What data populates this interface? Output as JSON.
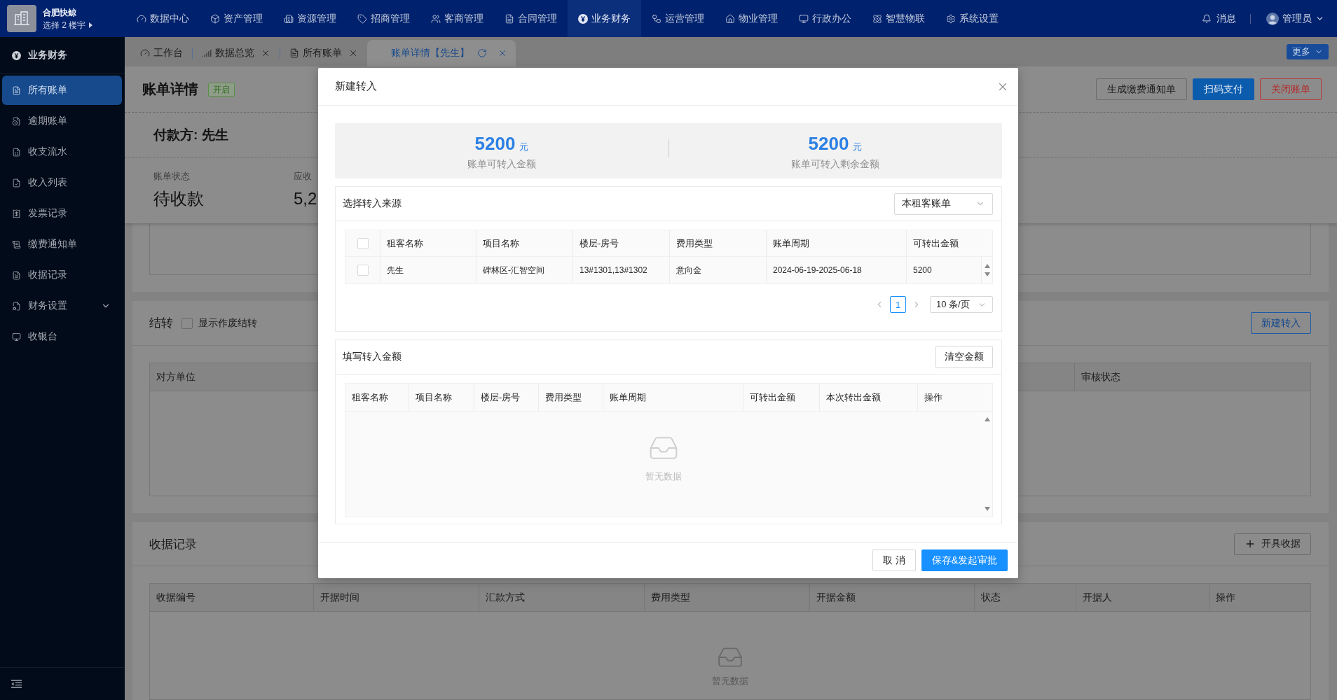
{
  "top_bar": {
    "brand_name": "合肥快鲸",
    "building_select": "选择 2 楼宇",
    "nav": [
      {
        "label": "数据中心",
        "selected": false
      },
      {
        "label": "资产管理",
        "selected": false
      },
      {
        "label": "资源管理",
        "selected": false
      },
      {
        "label": "招商管理",
        "selected": false
      },
      {
        "label": "客商管理",
        "selected": false
      },
      {
        "label": "合同管理",
        "selected": false
      },
      {
        "label": "业务财务",
        "selected": true
      },
      {
        "label": "运营管理",
        "selected": false
      },
      {
        "label": "物业管理",
        "selected": false
      },
      {
        "label": "行政办公",
        "selected": false
      },
      {
        "label": "智慧物联",
        "selected": false
      },
      {
        "label": "系统设置",
        "selected": false
      }
    ],
    "messages": "消息",
    "user": "管理员"
  },
  "sidebar": {
    "title": "业务财务",
    "items": [
      {
        "label": "所有账单",
        "selected": true,
        "kind": "link"
      },
      {
        "label": "逾期账单",
        "selected": false,
        "kind": "link"
      },
      {
        "label": "收支流水",
        "selected": false,
        "kind": "link"
      },
      {
        "label": "收入列表",
        "selected": false,
        "kind": "link"
      },
      {
        "label": "发票记录",
        "selected": false,
        "kind": "link"
      },
      {
        "label": "缴费通知单",
        "selected": false,
        "kind": "link"
      },
      {
        "label": "收据记录",
        "selected": false,
        "kind": "link"
      },
      {
        "label": "财务设置",
        "selected": false,
        "kind": "submenu"
      },
      {
        "label": "收银台",
        "selected": false,
        "kind": "link"
      }
    ]
  },
  "tabs": [
    {
      "label": "工作台",
      "selected": false,
      "closable": false
    },
    {
      "label": "数据总览",
      "selected": false,
      "closable": true
    },
    {
      "label": "所有账单",
      "selected": false,
      "closable": true
    },
    {
      "label": "账单详情【先生】",
      "selected": true,
      "closable": true
    }
  ],
  "more_button": "更多",
  "bill": {
    "title": "账单详情",
    "status_tag": "开启",
    "actions": [
      {
        "label": "生成缴费通知单",
        "kind": "default"
      },
      {
        "label": "扫码支付",
        "kind": "primary"
      },
      {
        "label": "关闭账单",
        "kind": "danger"
      }
    ],
    "payer": "付款方: 先生",
    "fields": [
      {
        "label": "账单状态",
        "value": "待收款"
      },
      {
        "label": "应收",
        "value": "5,2"
      }
    ]
  },
  "carryover": {
    "title": "结转",
    "show_void": {
      "label": "显示作废结转",
      "checked": false
    },
    "action": "新建转入",
    "columns": [
      "对方单位",
      "审核状态"
    ]
  },
  "receipts": {
    "title": "收据记录",
    "action": "开具收据",
    "columns": [
      "收据编号",
      "开据时间",
      "汇款方式",
      "费用类型",
      "开据金额",
      "状态",
      "开据人",
      "操作"
    ],
    "empty_text": "暂无数据"
  },
  "modal": {
    "title": "新建转入",
    "summary": [
      {
        "amount": "5200",
        "unit": "元",
        "label": "账单可转入金额"
      },
      {
        "amount": "5200",
        "unit": "元",
        "label": "账单可转入剩余金额"
      }
    ],
    "source": {
      "title": "选择转入来源",
      "select": "本租客账单",
      "all_checked": false,
      "columns": [
        "租客名称",
        "项目名称",
        "楼层-房号",
        "费用类型",
        "账单周期",
        "可转出金额"
      ],
      "rows": [
        {
          "checked": false,
          "cells": [
            "先生",
            "碑林区-汇智空间",
            "13#1301,13#1302",
            "意向金",
            "2024-06-19-2025-06-18",
            "5200"
          ]
        }
      ],
      "pagination": {
        "pages": [
          {
            "label": "1",
            "selected": true
          }
        ],
        "page_size": "10 条/页"
      }
    },
    "amounts": {
      "title": "填写转入金额",
      "clear_button": "清空金额",
      "columns": [
        "租客名称",
        "项目名称",
        "楼层-房号",
        "费用类型",
        "账单周期",
        "可转出金额",
        "本次转出金额",
        "操作"
      ],
      "empty_text": "暂无数据"
    },
    "buttons": [
      {
        "label": "取 消",
        "kind": "default"
      },
      {
        "label": "保存&发起审批",
        "kind": "primary"
      }
    ]
  }
}
